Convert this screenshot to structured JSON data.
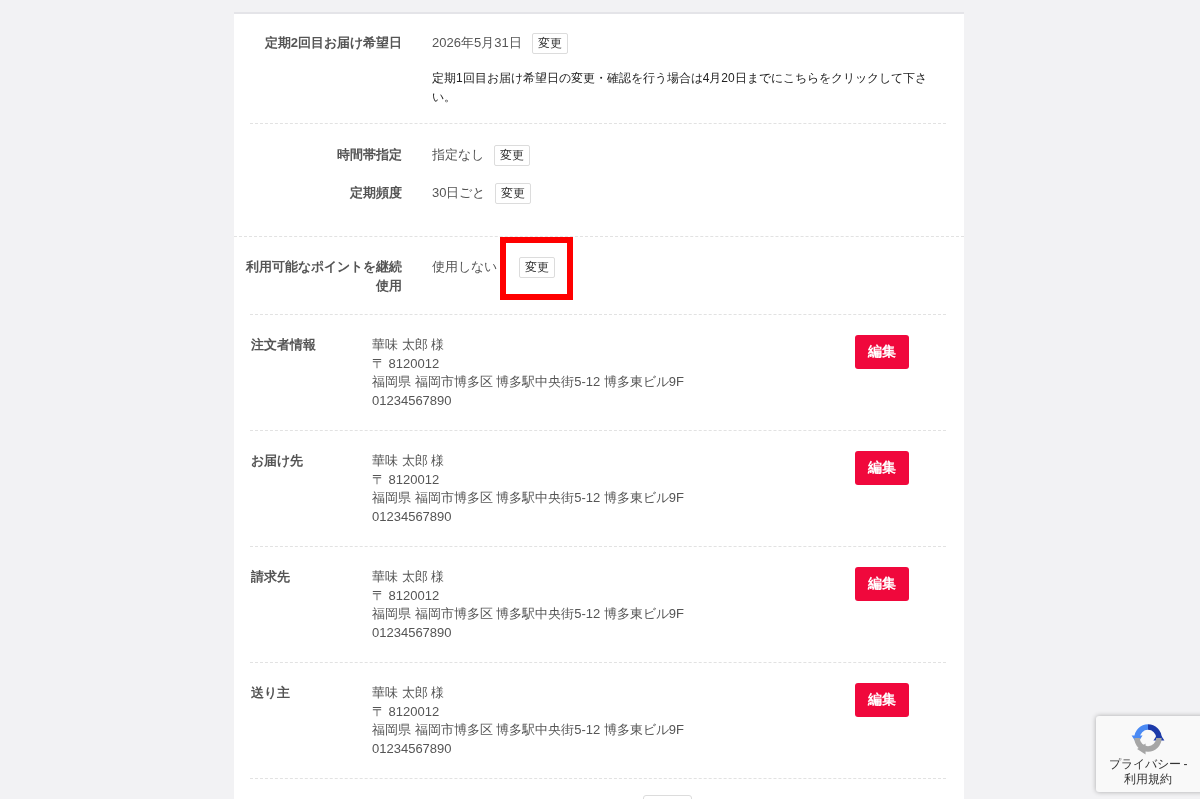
{
  "schedule_groups": [
    {
      "rows": [
        {
          "label": "定期2回目お届け希望日",
          "value": "2026年5月31日",
          "button": "変更",
          "note": "定期1回目お届け希望日の変更・確認を行う場合は4月20日までにこちらをクリックして下さい。"
        }
      ]
    },
    {
      "rows": [
        {
          "label": "時間帯指定",
          "value": "指定なし",
          "button": "変更"
        },
        {
          "label": "定期頻度",
          "value": "30日ごと",
          "button": "変更"
        }
      ]
    }
  ],
  "points": {
    "label": "利用可能なポイントを継続使用",
    "value": "使用しない",
    "button": "変更",
    "highlighted": true
  },
  "addresses": [
    {
      "label": "注文者情報",
      "name": "華味 太郎 様",
      "postal": "〒 8120012",
      "address": "福岡県 福岡市博多区 博多駅中央街5-12 博多東ビル9F",
      "phone": "01234567890",
      "button": "編集"
    },
    {
      "label": "お届け先",
      "name": "華味 太郎 様",
      "postal": "〒 8120012",
      "address": "福岡県 福岡市博多区 博多駅中央街5-12 博多東ビル9F",
      "phone": "01234567890",
      "button": "編集"
    },
    {
      "label": "請求先",
      "name": "華味 太郎 様",
      "postal": "〒 8120012",
      "address": "福岡県 福岡市博多区 博多駅中央街5-12 博多東ビル9F",
      "phone": "01234567890",
      "button": "編集"
    },
    {
      "label": "送り主",
      "name": "華味 太郎 様",
      "postal": "〒 8120012",
      "address": "福岡県 福岡市博多区 博多駅中央街5-12 博多東ビル9F",
      "phone": "01234567890",
      "button": "編集"
    }
  ],
  "recaptcha": {
    "privacy_link": "プライバシー",
    "separator": "-",
    "terms_link": "利用規約"
  }
}
